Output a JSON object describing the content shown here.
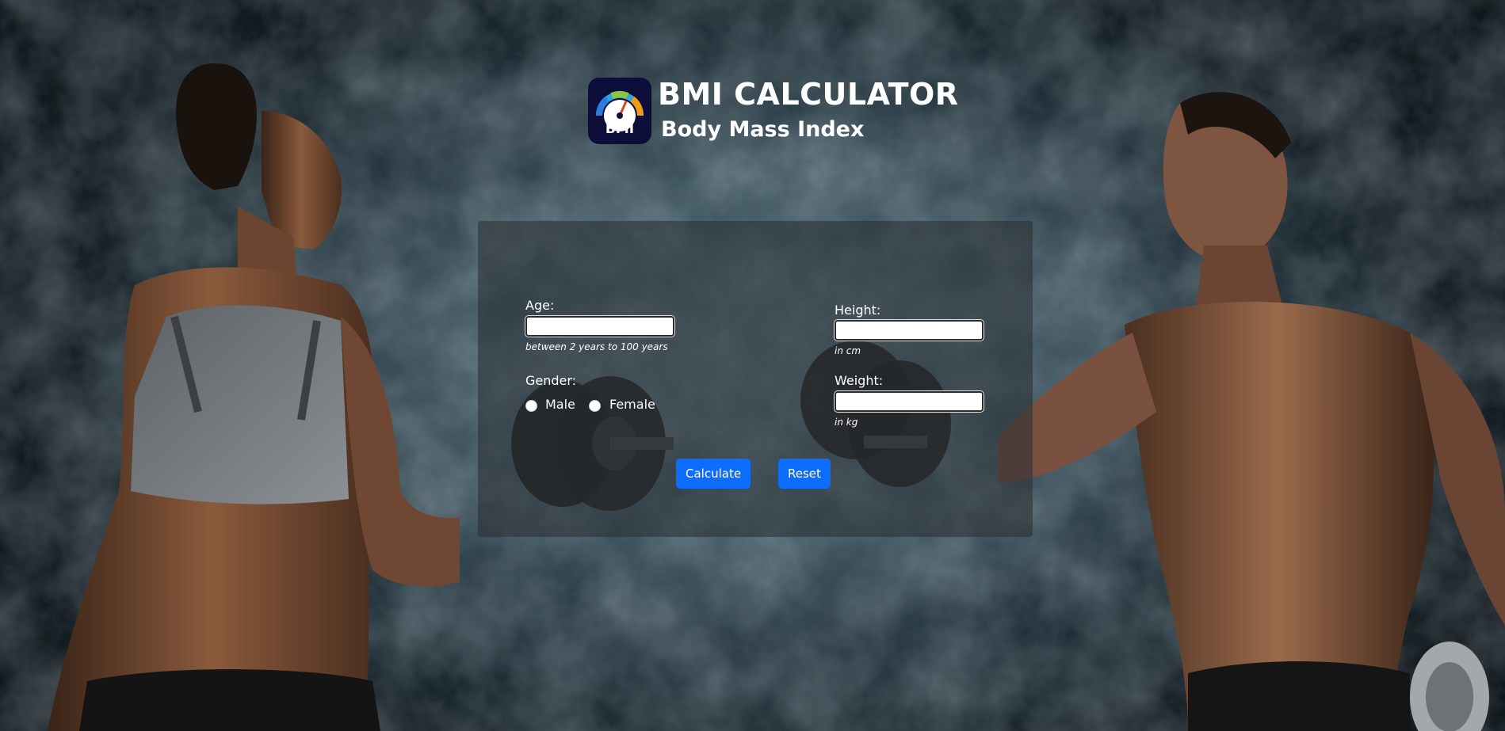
{
  "header": {
    "title": "BMI CALCULATOR",
    "subtitle": "Body Mass Index",
    "logo_text": "BMI"
  },
  "form": {
    "age": {
      "label": "Age:",
      "value": "",
      "hint": "between 2 years to 100 years"
    },
    "gender": {
      "label": "Gender:",
      "options": [
        "Male",
        "Female"
      ],
      "selected": null
    },
    "height": {
      "label": "Height:",
      "value": "",
      "hint": "in cm"
    },
    "weight": {
      "label": "Weight:",
      "value": "",
      "hint": "in kg"
    },
    "calculate_label": "Calculate",
    "reset_label": "Reset"
  },
  "colors": {
    "accent": "#0d6efd",
    "logo_bg": "#0d0d3a",
    "panel_bg": "rgba(40,46,50,0.55)"
  }
}
